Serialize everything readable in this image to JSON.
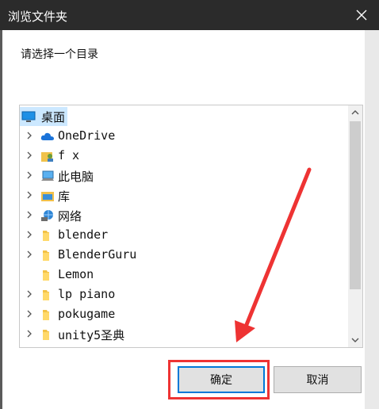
{
  "window": {
    "title": "浏览文件夹"
  },
  "dialog": {
    "prompt": "请选择一个目录"
  },
  "tree": {
    "items": [
      {
        "label": "桌面",
        "icon": "desktop-icon",
        "expandable": false,
        "selected": true
      },
      {
        "label": "OneDrive",
        "icon": "cloud-icon",
        "expandable": true
      },
      {
        "label": "f x",
        "icon": "user-folder-icon",
        "expandable": true
      },
      {
        "label": "此电脑",
        "icon": "computer-icon",
        "expandable": true
      },
      {
        "label": "库",
        "icon": "library-icon",
        "expandable": true
      },
      {
        "label": "网络",
        "icon": "network-icon",
        "expandable": true
      },
      {
        "label": "blender",
        "icon": "folder-icon",
        "expandable": true
      },
      {
        "label": "BlenderGuru",
        "icon": "folder-icon",
        "expandable": true
      },
      {
        "label": "Lemon",
        "icon": "folder-icon",
        "expandable": false
      },
      {
        "label": "lp piano",
        "icon": "folder-icon",
        "expandable": true
      },
      {
        "label": "pokugame",
        "icon": "folder-icon",
        "expandable": true
      },
      {
        "label": "unity5圣典",
        "icon": "folder-icon",
        "expandable": true
      }
    ]
  },
  "buttons": {
    "ok": "确定",
    "cancel": "取消"
  },
  "colors": {
    "titlebar": "#2b2b2b",
    "selection": "#cce8ff",
    "annotation": "#e33333",
    "accent": "#0078d7"
  }
}
